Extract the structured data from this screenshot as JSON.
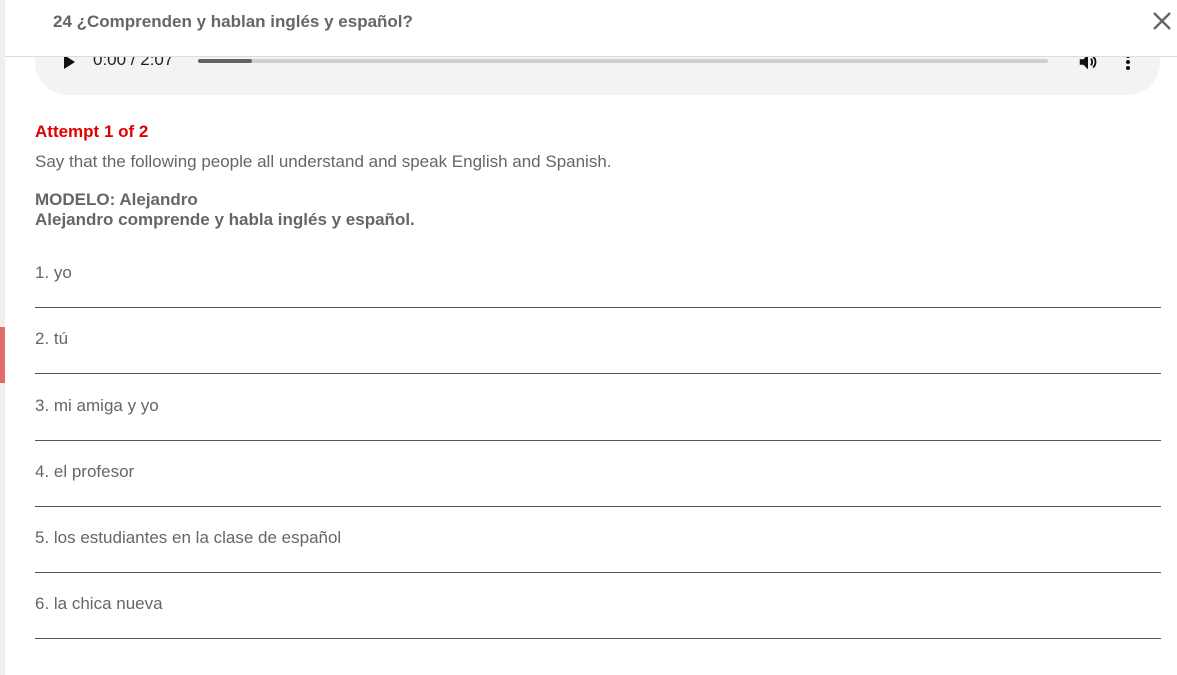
{
  "header": {
    "title": "24 ¿Comprenden y hablan inglés y español?"
  },
  "audio": {
    "time": "0:00 / 2:07",
    "progress_fraction": 0.063
  },
  "attempt": "Attempt 1 of 2",
  "instructions": "Say that the following people all understand and speak English and Spanish.",
  "model": {
    "line1": "MODELO: Alejandro",
    "line2": "Alejandro comprende y habla inglés y español."
  },
  "questions": [
    {
      "label": "1. yo",
      "value": ""
    },
    {
      "label": "2. tú",
      "value": ""
    },
    {
      "label": "3. mi amiga y yo",
      "value": ""
    },
    {
      "label": "4. el profesor",
      "value": ""
    },
    {
      "label": "5. los estudiantes en la clase de español",
      "value": ""
    },
    {
      "label": "6. la chica nueva",
      "value": ""
    }
  ],
  "colors": {
    "accent_red": "#e00000",
    "marker": "#e36a6a"
  }
}
